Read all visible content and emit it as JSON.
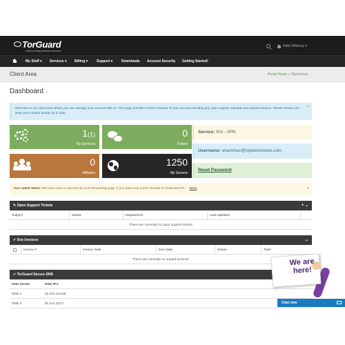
{
  "brand": {
    "name": "TorGuard",
    "tagline": "online privacy protection services"
  },
  "topbar": {
    "user_label": "Hello Whitney"
  },
  "nav": {
    "items": [
      "My Stuff",
      "Services",
      "Billing",
      "Support",
      "Downloads",
      "Account Security",
      "Getting Started!"
    ],
    "caret": "▾"
  },
  "subheader": {
    "title": "Client Area",
    "crumb_home": "Portal Home",
    "crumb_sep": " » ",
    "crumb_current": "Client Area"
  },
  "dashboard": {
    "title": "Dashboard",
    "chevron": "»"
  },
  "info_alert": {
    "text": "Welcome to our client area where you can manage your account with us. This page provides a brief overview of your account including any open support requests and unpaid invoices. Please ensure you keep your contact details up to date.",
    "close": "×"
  },
  "tiles": {
    "services": {
      "count": "1",
      "count_extra": "(1)",
      "label": "My Services"
    },
    "tickets": {
      "count": "0",
      "label": "Tickets"
    },
    "affiliates": {
      "count": "0",
      "label": "Affiliates"
    },
    "servers": {
      "count": "1250",
      "label": "My Servers"
    }
  },
  "service_info": {
    "service_label": "Service:",
    "service_value": "Pro - VPN",
    "username_label": "Username:",
    "username_value": "wsanchez@toptenreviews.com",
    "reset_label": "Reset Password"
  },
  "news": {
    "label": "Our Latest News:",
    "text": "We have now re-opened the port forwarding page, if you have had a port forward or Dedicated IP...",
    "more": "More",
    "close": "×"
  },
  "tickets_panel": {
    "title": "Open Support Tickets",
    "columns": [
      "Subject",
      "Status",
      "Department",
      "Last Updated"
    ],
    "empty": "There are currently no open support tickets",
    "controls": "+ ⌄"
  },
  "invoices_panel": {
    "title": "Due Invoices",
    "columns": [
      "Invoice #",
      "Invoice Date",
      "Due Date",
      "Status",
      "Total"
    ],
    "empty": "There are currently no unpaid invoices",
    "controls": "⌄"
  },
  "dns_panel": {
    "title": "TorGuard Secure DNS",
    "columns": [
      "DNS Server",
      "DNS IP's"
    ],
    "rows": [
      {
        "server": "DNS 1",
        "ip": "91.121.113.58"
      },
      {
        "server": "DNS 2",
        "ip": "91.121.113.7"
      }
    ]
  },
  "promo": {
    "text": "We are here!"
  },
  "chat": {
    "label": "Chat now"
  },
  "colors": {
    "green": "#7cac5d",
    "brown": "#b9773d",
    "dark": "#262626",
    "chat_blue": "#1a7bbf",
    "promo_purple": "#4b1f6f"
  }
}
